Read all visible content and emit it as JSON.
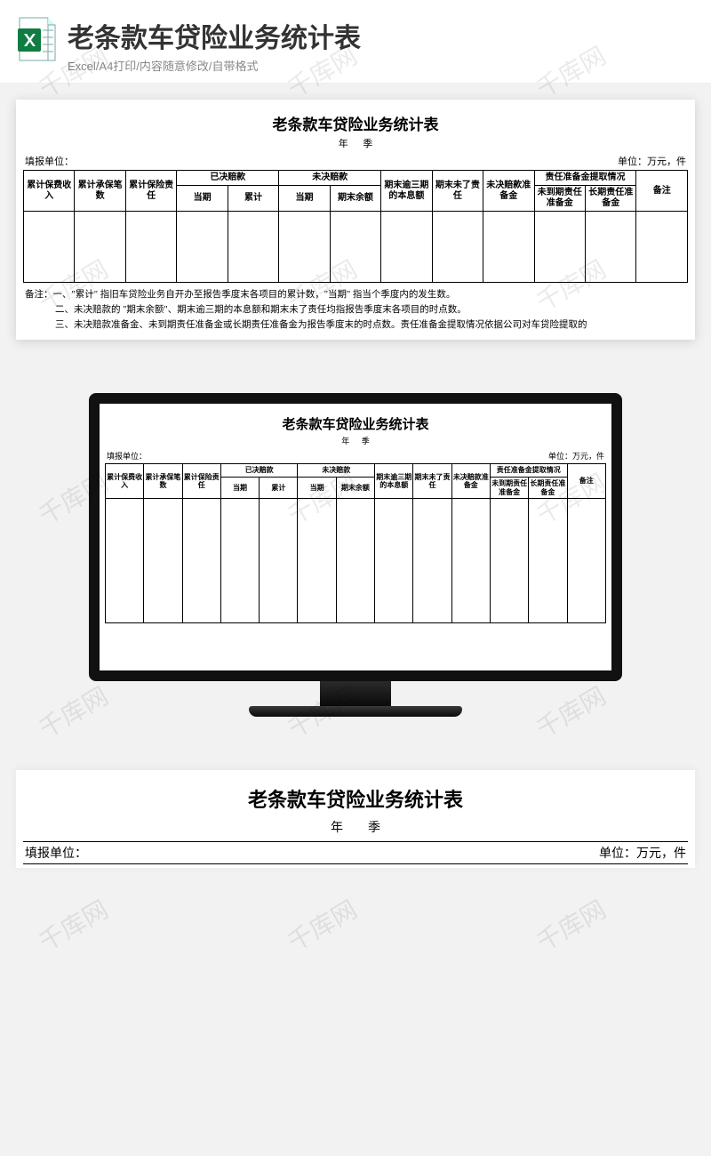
{
  "watermark_text": "千库网",
  "header": {
    "title": "老条款车贷险业务统计表",
    "subtitle": "Excel/A4打印/内容随意修改/自带格式"
  },
  "sheet": {
    "title": "老条款车贷险业务统计表",
    "subtitle_year": "年",
    "subtitle_quarter": "季",
    "meta_left": "填报单位：",
    "meta_right": "单位：万元，件",
    "headers": {
      "c1": "累计保费收入",
      "c2": "累计承保笔数",
      "c3": "累计保险责任",
      "g_settled": "已决赔款",
      "g_settled_a": "当期",
      "g_settled_b": "累计",
      "g_pending": "未决赔款",
      "g_pending_a": "当期",
      "g_pending_b": "期末余额",
      "c_overdue": "期末逾三期的本息额",
      "c_unliab": "期末未了责任",
      "c_reserve": "未决赔款准备金",
      "g_draw": "责任准备金提取情况",
      "g_draw_a": "未到期责任准备金",
      "g_draw_b": "长期责任准备金",
      "c_remark": "备注"
    },
    "notes_prefix": "备注：",
    "notes": [
      "一、\"累计\" 指旧车贷险业务自开办至报告季度末各项目的累计数，\"当期\" 指当个季度内的发生数。",
      "二、未决赔款的 \"期末余额\"、期末逾三期的本息额和期末未了责任均指报告季度末各项目的时点数。",
      "三、未决赔款准备金、未到期责任准备金或长期责任准备金为报告季度末的时点数。责任准备金提取情况依据公司对车贷险提取的"
    ]
  }
}
